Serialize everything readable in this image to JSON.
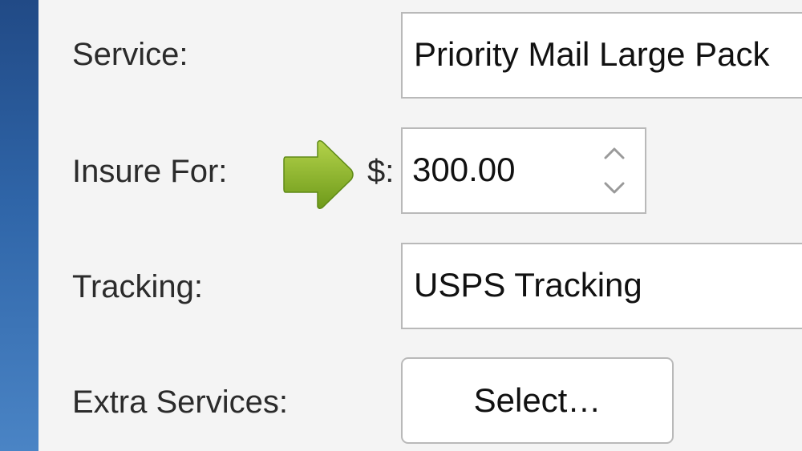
{
  "form": {
    "service": {
      "label": "Service:",
      "value": "Priority Mail Large Pack"
    },
    "insure_for": {
      "label": "Insure For:",
      "currency_symbol": "$:",
      "value": "300.00"
    },
    "tracking": {
      "label": "Tracking:",
      "value": "USPS Tracking"
    },
    "extra_services": {
      "label": "Extra Services:",
      "button_label": "Select…"
    }
  },
  "icons": {
    "pointer": "arrow-right-icon",
    "stepper_up": "chevron-up-icon",
    "stepper_down": "chevron-down-icon"
  },
  "colors": {
    "sidebar": "#2f65a8",
    "arrow": "#8fb72c",
    "field_border": "#b9b9b9",
    "background": "#f4f4f4"
  }
}
